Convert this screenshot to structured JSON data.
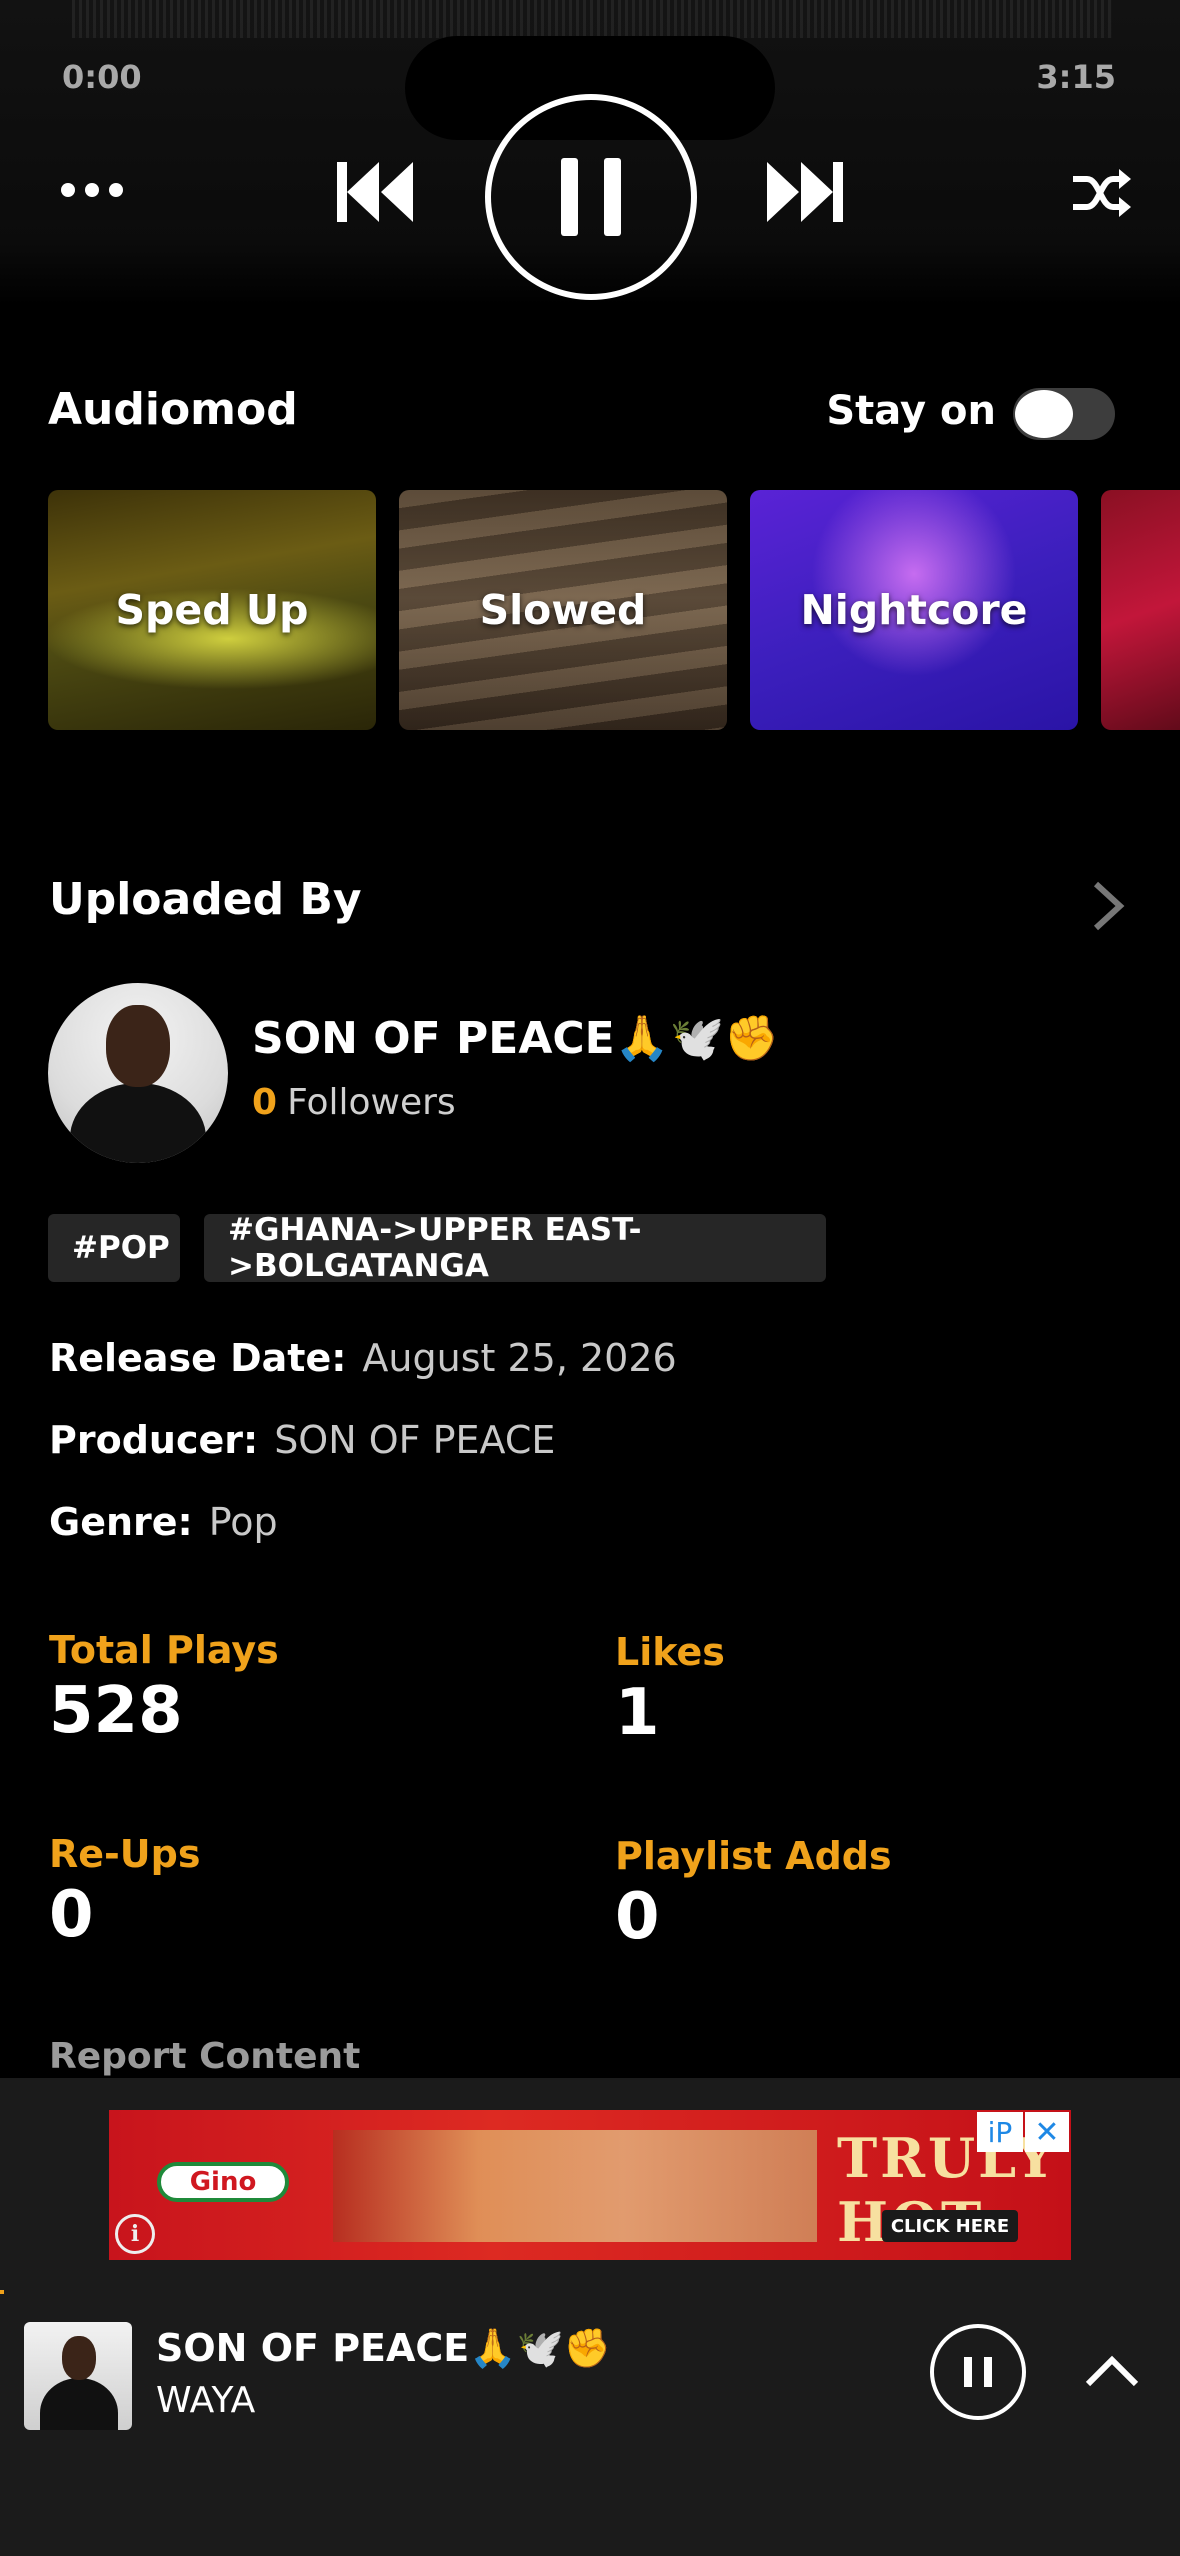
{
  "player": {
    "elapsed": "0:00",
    "duration": "3:15",
    "state": "playing"
  },
  "audiomod": {
    "title": "Audiomod",
    "stay_on_label": "Stay on",
    "stay_on_enabled": false,
    "cards": [
      {
        "label": "Sped Up"
      },
      {
        "label": "Slowed"
      },
      {
        "label": "Nightcore"
      }
    ]
  },
  "uploaded_by": {
    "title": "Uploaded By",
    "artist_name": "SON OF PEACE🙏🕊️✊",
    "followers_count": "0",
    "followers_label": "Followers"
  },
  "tags": [
    "#POP",
    "#GHANA->UPPER EAST->BOLGATANGA"
  ],
  "meta": {
    "release_label": "Release Date:",
    "release_value": "August 25, 2026",
    "producer_label": "Producer:",
    "producer_value": "SON OF PEACE",
    "genre_label": "Genre:",
    "genre_value": "Pop"
  },
  "stats": {
    "total_plays_label": "Total Plays",
    "total_plays": "528",
    "likes_label": "Likes",
    "likes": "1",
    "reups_label": "Re-Ups",
    "reups": "0",
    "playlist_adds_label": "Playlist Adds",
    "playlist_adds": "0"
  },
  "report_label": "Report Content",
  "ad": {
    "brand": "Gino",
    "headline": "TRULY HOT",
    "cta": "CLICK HERE",
    "ip_label": "iP",
    "close_label": "✕",
    "info_label": "i"
  },
  "mini_player": {
    "title": "SON OF PEACE🙏🕊️✊",
    "subtitle": "WAYA"
  },
  "colors": {
    "accent": "#f0a21b",
    "background": "#000000",
    "panel": "#1b1b1b",
    "tag_bg": "#262626"
  }
}
